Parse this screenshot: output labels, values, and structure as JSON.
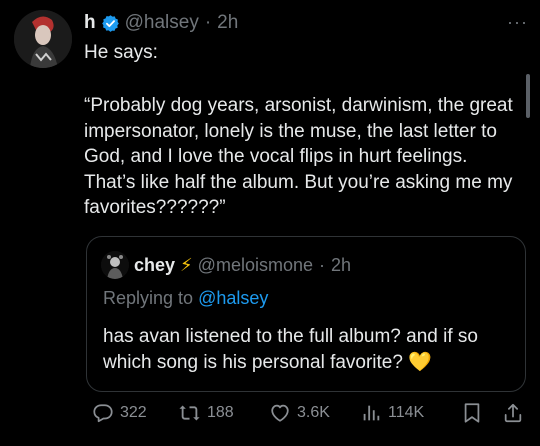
{
  "tweet": {
    "author_name": "h",
    "handle": "@halsey",
    "separator": "·",
    "time": "2h",
    "intro": "He says:",
    "body": "“Probably dog years, arsonist, darwinism, the great impersonator, lonely is the muse, the last letter to God, and I love the vocal flips in hurt feelings. That’s like half the album. But you’re asking me my favorites??????”",
    "more_label": "···"
  },
  "quote": {
    "author_name": "chey",
    "bolt": "⚡",
    "handle": "@meloismone",
    "separator": "·",
    "time": "2h",
    "replying_prefix": "Replying to",
    "replying_handle": "@halsey",
    "text": "has avan listened to the full album? and if so which song is his personal favorite?",
    "emoji": "💛"
  },
  "actions": {
    "replies": "322",
    "retweets": "188",
    "likes": "3.6K",
    "views": "114K"
  },
  "colors": {
    "background": "#000000",
    "text": "#e7e9ea",
    "muted": "#71767b",
    "link": "#1d9bf0",
    "verified": "#1d9bf0"
  },
  "icons": [
    "verified-badge-icon",
    "more-icon",
    "reply-icon",
    "retweet-icon",
    "like-icon",
    "views-icon",
    "bookmark-icon",
    "share-icon",
    "lightning-icon",
    "yellow-heart-icon"
  ]
}
